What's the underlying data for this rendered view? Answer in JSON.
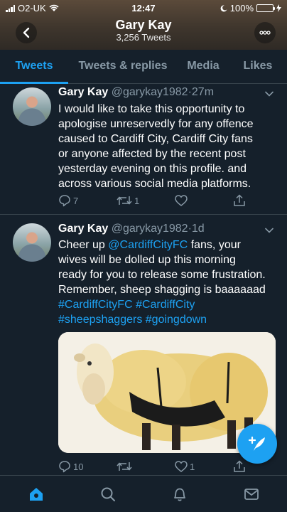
{
  "status_bar": {
    "carrier": "O2-UK",
    "time": "12:47",
    "battery": "100%"
  },
  "header": {
    "title": "Gary Kay",
    "subtitle": "3,256 Tweets"
  },
  "tabs": [
    {
      "label": "Tweets",
      "active": true
    },
    {
      "label": "Tweets & replies",
      "active": false
    },
    {
      "label": "Media",
      "active": false
    },
    {
      "label": "Likes",
      "active": false
    }
  ],
  "tweets": [
    {
      "name": "Gary Kay",
      "handle": "@garykay1982",
      "time": "27m",
      "lines": [
        "I would like to take this opportunity to",
        "apologise unreservedly for any offence",
        "caused to Cardiff City, Cardiff City fans",
        "or anyone affected by the recent post",
        "yesterday evening on this profile. and",
        "across various social media platforms."
      ],
      "replies": "7",
      "retweets": "1",
      "likes": ""
    },
    {
      "name": "Gary Kay",
      "handle": "@garykay1982",
      "time": "1d",
      "text_parts": {
        "p1": "Cheer up ",
        "mention": "@CardiffCityFC",
        "p2": " fans, your",
        "line2": "wives will be dolled up this morning",
        "line3": "ready for you to release some frustration.",
        "line4": "Remember, sheep shagging is baaaaaad",
        "tag1": "#CardiffCityFC",
        "tag2": "#CardiffCity",
        "tag3": "#sheepshaggers",
        "tag4": "#goingdown"
      },
      "replies": "10",
      "retweets": "",
      "likes": "1"
    }
  ],
  "colors": {
    "accent": "#1da1f2",
    "background": "#15202b",
    "muted": "#8899a6"
  }
}
